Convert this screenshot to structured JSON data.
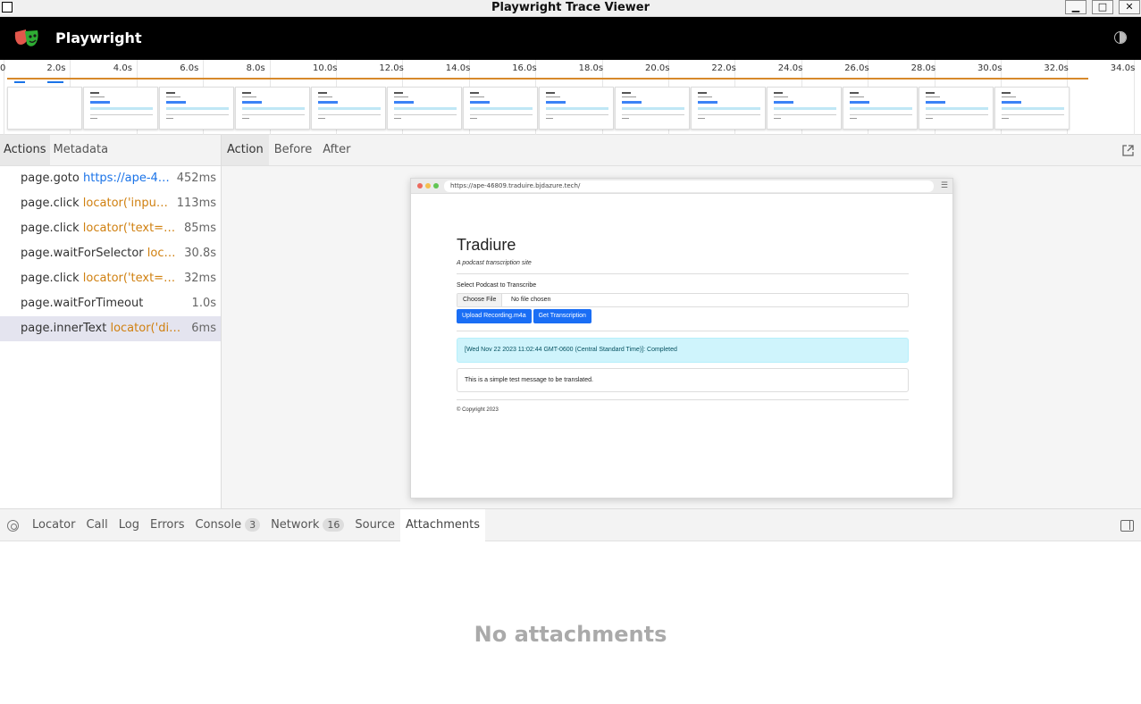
{
  "window": {
    "title": "Playwright Trace Viewer",
    "minimize": "▁",
    "maximize": "□",
    "close": "✕"
  },
  "header": {
    "app_name": "Playwright"
  },
  "timeline": {
    "ticks": [
      "0",
      "2.0s",
      "4.0s",
      "6.0s",
      "8.0s",
      "10.0s",
      "12.0s",
      "14.0s",
      "16.0s",
      "18.0s",
      "20.0s",
      "22.0s",
      "24.0s",
      "26.0s",
      "28.0s",
      "30.0s",
      "32.0s",
      "34.0s"
    ],
    "frame_count": 14
  },
  "left_tabs": [
    "Actions",
    "Metadata"
  ],
  "actions": [
    {
      "name": "page.goto",
      "arg": "https://ape-4…",
      "arg_type": "url",
      "duration": "452ms"
    },
    {
      "name": "page.click",
      "arg": "locator('input…",
      "arg_type": "loc",
      "duration": "113ms"
    },
    {
      "name": "page.click",
      "arg": "locator('text=…",
      "arg_type": "loc",
      "duration": "85ms"
    },
    {
      "name": "page.waitForSelector",
      "arg": "loc…",
      "arg_type": "loc",
      "duration": "30.8s"
    },
    {
      "name": "page.click",
      "arg": "locator('text=…",
      "arg_type": "loc",
      "duration": "32ms"
    },
    {
      "name": "page.waitForTimeout",
      "arg": "",
      "arg_type": "loc",
      "duration": "1.0s"
    },
    {
      "name": "page.innerText",
      "arg": "locator('div…",
      "arg_type": "loc",
      "duration": "6ms",
      "selected": true
    }
  ],
  "right_tabs": [
    "Action",
    "Before",
    "After"
  ],
  "snapshot": {
    "url": "https://ape-46809.traduire.bjdazure.tech/",
    "menu": "☰",
    "title": "Tradiure",
    "subtitle": "A podcast transcription site",
    "select_label": "Select Podcast to Transcribe",
    "choose_file": "Choose File",
    "no_file": "No file chosen",
    "upload_btn": "Upload Recording.m4a",
    "get_btn": "Get Transcription",
    "alert": "[Wed Nov 22 2023 11:02:44 GMT-0600 (Central Standard Time)]: Completed",
    "message": "This is a simple test message to be translated.",
    "footer": "© Copyright 2023"
  },
  "bottom_tabs": [
    {
      "label": "Locator"
    },
    {
      "label": "Call"
    },
    {
      "label": "Log"
    },
    {
      "label": "Errors"
    },
    {
      "label": "Console",
      "count": "3"
    },
    {
      "label": "Network",
      "count": "16"
    },
    {
      "label": "Source"
    },
    {
      "label": "Attachments",
      "active": true
    }
  ],
  "attachments_empty": "No attachments"
}
